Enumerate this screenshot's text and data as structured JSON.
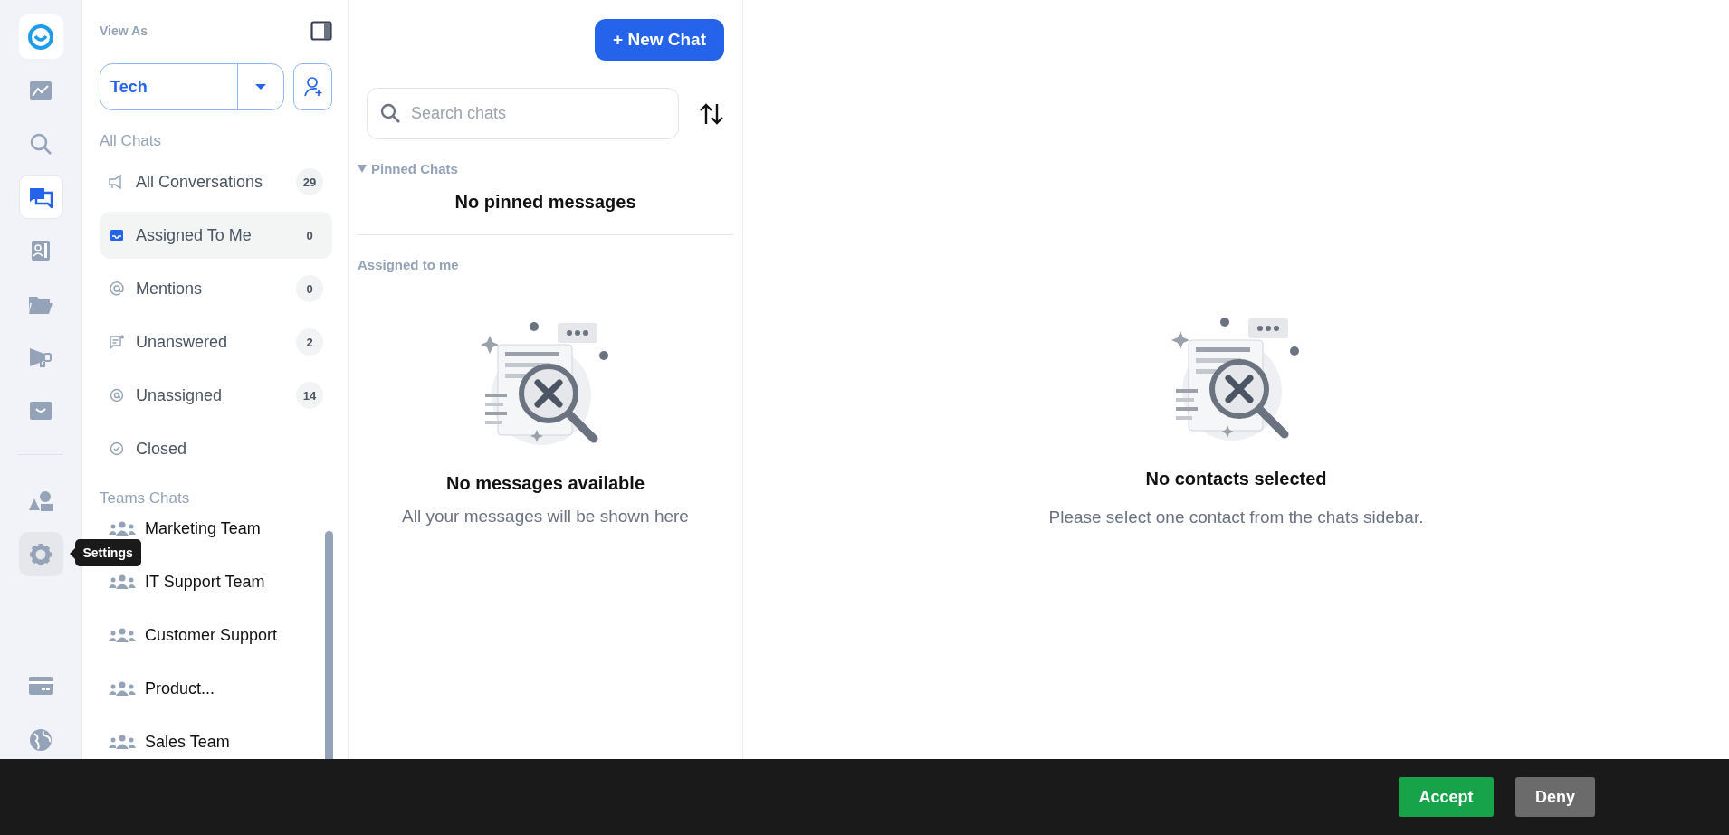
{
  "rail": {
    "items": [
      {
        "selected": false
      },
      {
        "selected": false
      },
      {
        "selected": false
      },
      {
        "selected": true
      },
      {
        "selected": false
      },
      {
        "selected": false
      },
      {
        "selected": false
      },
      {
        "selected": false
      }
    ],
    "tooltip": "Settings"
  },
  "sidebar": {
    "view_as_label": "View As",
    "view_as_value": "Tech",
    "all_chats_heading": "All Chats",
    "items": [
      {
        "label": "All Conversations",
        "count": "29",
        "selected": false
      },
      {
        "label": "Assigned To Me",
        "count": "0",
        "selected": true
      },
      {
        "label": "Mentions",
        "count": "0",
        "selected": false
      },
      {
        "label": "Unanswered",
        "count": "2",
        "selected": false
      },
      {
        "label": "Unassigned",
        "count": "14",
        "selected": false
      },
      {
        "label": "Closed",
        "selected": false
      }
    ],
    "teams_heading": "Teams Chats",
    "teams": [
      {
        "label": "Marketing Team"
      },
      {
        "label": "IT Support Team"
      },
      {
        "label": "Customer Support"
      },
      {
        "label": "Product..."
      },
      {
        "label": "Sales Team"
      }
    ]
  },
  "chat_list": {
    "new_chat_button": "+ New Chat",
    "search": {
      "placeholder": "Search chats"
    },
    "pinned_heading": "Pinned Chats",
    "pinned_expanded": true,
    "pinned_empty": "No pinned messages",
    "assigned_heading": "Assigned to me",
    "empty_title": "No messages available",
    "empty_text": "All your messages will be shown here"
  },
  "detail": {
    "empty_title": "No contacts selected",
    "empty_text": "Please select one contact from the chats sidebar."
  },
  "cookie_banner": {
    "buttons": [
      {
        "label": "Accept",
        "kind": "accept"
      },
      {
        "label": "Deny",
        "kind": "deny"
      }
    ]
  }
}
